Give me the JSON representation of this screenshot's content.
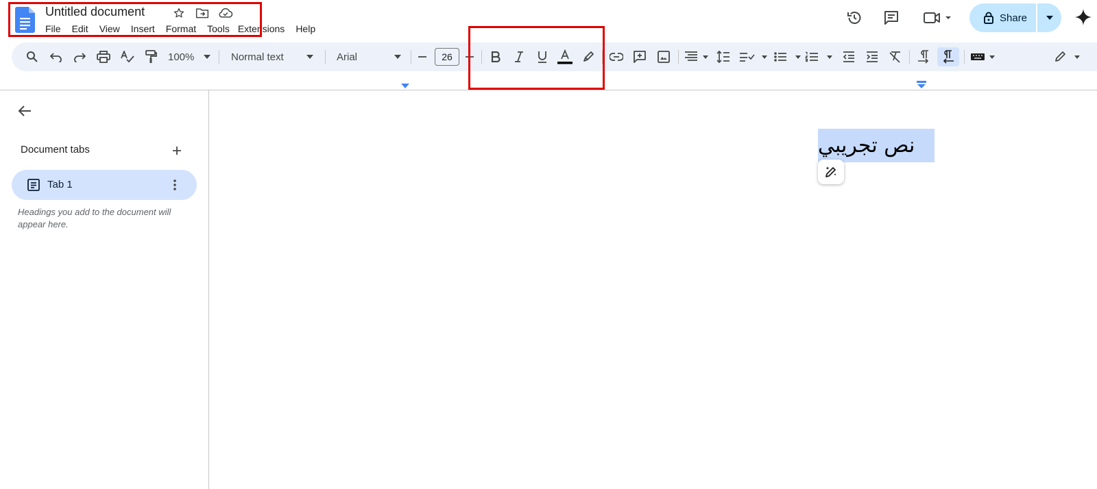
{
  "document": {
    "title": "Untitled document",
    "body_text": "نص تجريبي"
  },
  "menu": [
    "File",
    "Edit",
    "View",
    "Insert",
    "Format",
    "Tools",
    "Extensions",
    "Help"
  ],
  "header": {
    "share_label": "Share",
    "icons": [
      "history-icon",
      "comment-icon",
      "meet-icon",
      "lock-icon",
      "gemini-icon"
    ]
  },
  "toolbar": {
    "zoom": "100%",
    "style": "Normal text",
    "font": "Arial",
    "font_size": "26"
  },
  "sidebar": {
    "heading": "Document tabs",
    "tab_label": "Tab 1",
    "hint": "Headings you add to the document will appear here."
  },
  "colors": {
    "accent": "#1a73e8",
    "share_bg": "#c2e7ff",
    "toolbar_bg": "#edf2fa",
    "selection": "#c6dafc",
    "annotation": "#e00000",
    "text_color_bar": "#000000"
  }
}
